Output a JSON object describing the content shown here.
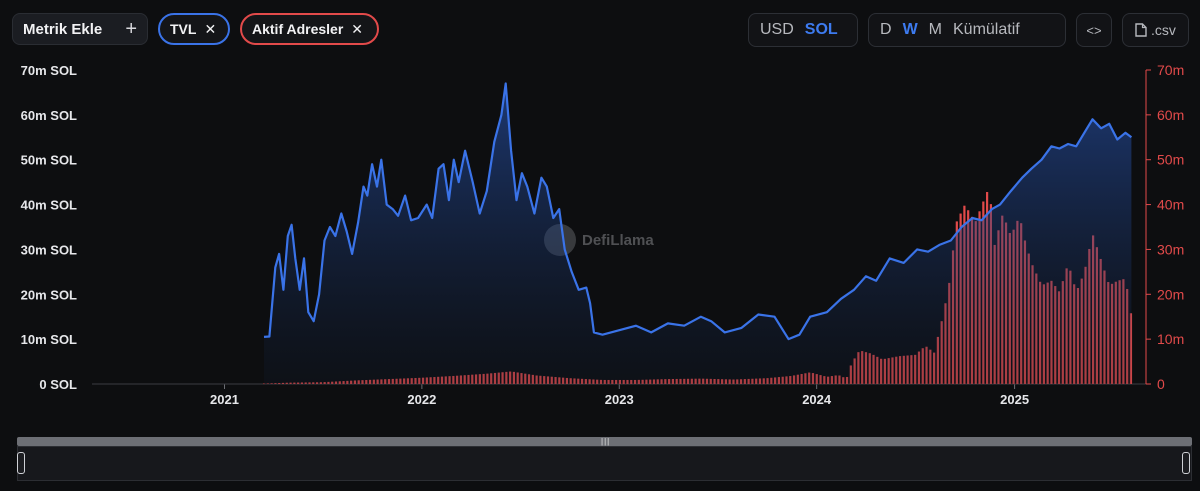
{
  "toolbar": {
    "metric_add_label": "Metrik Ekle",
    "metric_add_icon": "+",
    "chips": [
      {
        "label": "TVL",
        "color": "#3a73e8"
      },
      {
        "label": "Aktif Adresler",
        "color": "#e24a4a"
      }
    ],
    "currency": [
      "USD",
      "SOL"
    ],
    "currency_selected": "SOL",
    "frequency": [
      "D",
      "W",
      "M",
      "Kümülatif"
    ],
    "frequency_selected": "W",
    "embed_icon": "<>",
    "csv_label": ".csv",
    "csv_icon": "file-icon"
  },
  "watermark": "DefiLlama",
  "chart_data": {
    "type": "line",
    "left_axis": {
      "ticks": [
        "0 SOL",
        "10m SOL",
        "20m SOL",
        "30m SOL",
        "40m SOL",
        "50m SOL",
        "60m SOL",
        "70m SOL"
      ],
      "min": 0,
      "max": 70
    },
    "right_axis": {
      "ticks": [
        "0",
        "10m",
        "20m",
        "30m",
        "40m",
        "50m",
        "60m",
        "70m"
      ],
      "min": 0,
      "max": 70
    },
    "x_ticks": [
      "2021",
      "2022",
      "2023",
      "2024",
      "2025"
    ],
    "x_range": [
      "2020-05",
      "2025-09"
    ],
    "series": [
      {
        "name": "TVL",
        "type": "area",
        "color": "#3a73e8",
        "unit": "m SOL",
        "points": [
          [
            "2021-03-15",
            10.5
          ],
          [
            "2021-03-25",
            10.6
          ],
          [
            "2021-04-05",
            26
          ],
          [
            "2021-04-12",
            29
          ],
          [
            "2021-04-20",
            21
          ],
          [
            "2021-04-28",
            33
          ],
          [
            "2021-05-05",
            35.5
          ],
          [
            "2021-05-12",
            28
          ],
          [
            "2021-05-20",
            21
          ],
          [
            "2021-05-28",
            28
          ],
          [
            "2021-06-05",
            16
          ],
          [
            "2021-06-15",
            14
          ],
          [
            "2021-06-25",
            20
          ],
          [
            "2021-07-05",
            32
          ],
          [
            "2021-07-15",
            35
          ],
          [
            "2021-07-25",
            33
          ],
          [
            "2021-08-05",
            38
          ],
          [
            "2021-08-15",
            34
          ],
          [
            "2021-08-25",
            29
          ],
          [
            "2021-09-05",
            36
          ],
          [
            "2021-09-15",
            44
          ],
          [
            "2021-09-22",
            42
          ],
          [
            "2021-10-01",
            49
          ],
          [
            "2021-10-10",
            44
          ],
          [
            "2021-10-18",
            50
          ],
          [
            "2021-10-28",
            40
          ],
          [
            "2021-11-08",
            39
          ],
          [
            "2021-11-18",
            37.5
          ],
          [
            "2021-12-01",
            42
          ],
          [
            "2021-12-12",
            36.5
          ],
          [
            "2021-12-25",
            37
          ],
          [
            "2022-01-10",
            40
          ],
          [
            "2022-01-20",
            37
          ],
          [
            "2022-02-01",
            48
          ],
          [
            "2022-02-10",
            49
          ],
          [
            "2022-02-20",
            41
          ],
          [
            "2022-03-01",
            50
          ],
          [
            "2022-03-10",
            45
          ],
          [
            "2022-03-22",
            52
          ],
          [
            "2022-04-05",
            45
          ],
          [
            "2022-04-18",
            38
          ],
          [
            "2022-05-01",
            43
          ],
          [
            "2022-05-15",
            54
          ],
          [
            "2022-05-28",
            60
          ],
          [
            "2022-06-05",
            67
          ],
          [
            "2022-06-15",
            52
          ],
          [
            "2022-06-25",
            41
          ],
          [
            "2022-07-05",
            47
          ],
          [
            "2022-07-15",
            44
          ],
          [
            "2022-07-28",
            38
          ],
          [
            "2022-08-10",
            46
          ],
          [
            "2022-08-20",
            44
          ],
          [
            "2022-09-01",
            37
          ],
          [
            "2022-09-12",
            39
          ],
          [
            "2022-09-22",
            30
          ],
          [
            "2022-10-05",
            25
          ],
          [
            "2022-10-18",
            21
          ],
          [
            "2022-11-01",
            21.5
          ],
          [
            "2022-11-08",
            18
          ],
          [
            "2022-11-15",
            11.5
          ],
          [
            "2022-12-01",
            11
          ],
          [
            "2023-01-01",
            12
          ],
          [
            "2023-02-01",
            13
          ],
          [
            "2023-03-01",
            11.5
          ],
          [
            "2023-04-01",
            13.5
          ],
          [
            "2023-05-01",
            13
          ],
          [
            "2023-06-01",
            15
          ],
          [
            "2023-06-20",
            14
          ],
          [
            "2023-07-15",
            11.5
          ],
          [
            "2023-08-15",
            12.5
          ],
          [
            "2023-09-15",
            15.5
          ],
          [
            "2023-10-15",
            15
          ],
          [
            "2023-11-10",
            10
          ],
          [
            "2023-11-30",
            11
          ],
          [
            "2023-12-20",
            15
          ],
          [
            "2024-01-20",
            16
          ],
          [
            "2024-02-15",
            19
          ],
          [
            "2024-03-10",
            21
          ],
          [
            "2024-04-01",
            24
          ],
          [
            "2024-04-20",
            23
          ],
          [
            "2024-05-15",
            28
          ],
          [
            "2024-06-10",
            27
          ],
          [
            "2024-07-05",
            30
          ],
          [
            "2024-07-25",
            29.5
          ],
          [
            "2024-08-15",
            31
          ],
          [
            "2024-09-05",
            32
          ],
          [
            "2024-09-25",
            35
          ],
          [
            "2024-10-15",
            37
          ],
          [
            "2024-11-01",
            36.5
          ],
          [
            "2024-11-20",
            39
          ],
          [
            "2024-12-05",
            40
          ],
          [
            "2024-12-25",
            43
          ],
          [
            "2025-01-15",
            46
          ],
          [
            "2025-02-01",
            48
          ],
          [
            "2025-02-20",
            50
          ],
          [
            "2025-03-10",
            53
          ],
          [
            "2025-03-25",
            52.5
          ],
          [
            "2025-04-10",
            53.5
          ],
          [
            "2025-04-25",
            53
          ],
          [
            "2025-05-10",
            56
          ],
          [
            "2025-05-25",
            59
          ],
          [
            "2025-06-10",
            57
          ],
          [
            "2025-06-25",
            58
          ],
          [
            "2025-07-10",
            54.5
          ],
          [
            "2025-07-25",
            56
          ],
          [
            "2025-08-05",
            55
          ]
        ]
      },
      {
        "name": "Aktif Adresler",
        "type": "bar",
        "color": "#e24a4a",
        "unit": "m",
        "bars": [
          [
            "2021-03-15",
            0.1
          ],
          [
            "2021-05-01",
            0.3
          ],
          [
            "2021-07-01",
            0.4
          ],
          [
            "2021-09-01",
            0.8
          ],
          [
            "2021-11-01",
            1.1
          ],
          [
            "2022-01-01",
            1.4
          ],
          [
            "2022-03-01",
            1.8
          ],
          [
            "2022-05-01",
            2.3
          ],
          [
            "2022-06-15",
            2.8
          ],
          [
            "2022-08-01",
            1.9
          ],
          [
            "2022-10-01",
            1.3
          ],
          [
            "2022-12-01",
            0.9
          ],
          [
            "2023-02-01",
            0.9
          ],
          [
            "2023-04-01",
            1.1
          ],
          [
            "2023-06-01",
            1.2
          ],
          [
            "2023-08-01",
            1.0
          ],
          [
            "2023-10-01",
            1.3
          ],
          [
            "2023-11-15",
            1.8
          ],
          [
            "2023-12-20",
            2.6
          ],
          [
            "2024-01-20",
            1.6
          ],
          [
            "2024-02-10",
            2.0
          ],
          [
            "2024-02-25",
            1.2
          ],
          [
            "2024-03-05",
            4.5
          ],
          [
            "2024-03-20",
            7.5
          ],
          [
            "2024-04-10",
            6.8
          ],
          [
            "2024-05-01",
            5.5
          ],
          [
            "2024-06-01",
            6.2
          ],
          [
            "2024-07-01",
            6.5
          ],
          [
            "2024-07-20",
            8.5
          ],
          [
            "2024-08-05",
            7.0
          ],
          [
            "2024-08-20",
            14.5
          ],
          [
            "2024-09-01",
            21.5
          ],
          [
            "2024-09-15",
            36.0
          ],
          [
            "2024-10-01",
            40.0
          ],
          [
            "2024-10-20",
            36.0
          ],
          [
            "2024-11-05",
            41.0
          ],
          [
            "2024-11-15",
            44.0
          ],
          [
            "2024-11-25",
            31.0
          ],
          [
            "2024-12-10",
            38.0
          ],
          [
            "2024-12-25",
            33.0
          ],
          [
            "2025-01-10",
            37.5
          ],
          [
            "2025-01-20",
            32.0
          ],
          [
            "2025-02-01",
            27.0
          ],
          [
            "2025-02-20",
            22.0
          ],
          [
            "2025-03-10",
            23.0
          ],
          [
            "2025-03-25",
            20.5
          ],
          [
            "2025-04-10",
            27.0
          ],
          [
            "2025-04-25",
            20.5
          ],
          [
            "2025-05-10",
            25.0
          ],
          [
            "2025-05-25",
            33.5
          ],
          [
            "2025-06-10",
            27.5
          ],
          [
            "2025-06-25",
            22.0
          ],
          [
            "2025-07-10",
            23.0
          ],
          [
            "2025-07-25",
            23.5
          ],
          [
            "2025-08-05",
            15.0
          ]
        ]
      }
    ],
    "grid": false,
    "legend": "top-left"
  }
}
